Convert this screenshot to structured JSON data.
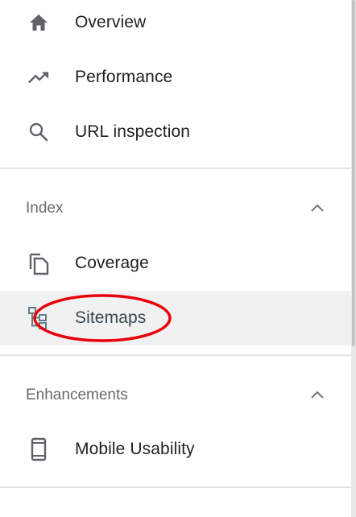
{
  "nav": {
    "top_items": [
      {
        "label": "Overview",
        "icon": "home-icon"
      },
      {
        "label": "Performance",
        "icon": "trending-up-icon"
      },
      {
        "label": "URL inspection",
        "icon": "search-icon"
      }
    ]
  },
  "index_section": {
    "title": "Index",
    "expanded": true,
    "items": [
      {
        "label": "Coverage",
        "icon": "file-copy-icon"
      },
      {
        "label": "Sitemaps",
        "icon": "sitemap-icon",
        "active": true
      }
    ]
  },
  "enhancements_section": {
    "title": "Enhancements",
    "expanded": true,
    "items": [
      {
        "label": "Mobile Usability",
        "icon": "smartphone-icon"
      }
    ]
  },
  "colors": {
    "icon": "#5f6368",
    "text": "#202124",
    "section_title": "#6b6b6b",
    "active_bg": "#f1f1f1",
    "annotation_ring": "#e8000b",
    "sitemap_icon": "#607d8b"
  }
}
